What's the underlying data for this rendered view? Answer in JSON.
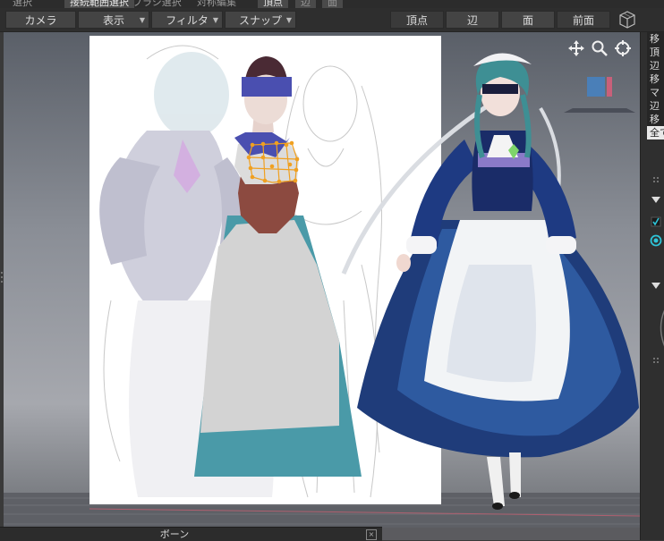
{
  "top_modes": [
    "選択",
    "接続範囲選択",
    "ブラシ選択",
    "対称編集",
    "頂点",
    "辺",
    "面"
  ],
  "toolbar": {
    "camera_label": "カメラ",
    "view_label": "表示",
    "filter_label": "フィルタ",
    "snap_label": "スナップ",
    "vertex_label": "頂点",
    "edge_label": "辺",
    "face_label": "面",
    "front_label": "前面",
    "cube_icon": "cube-view-icon"
  },
  "viewport": {
    "nav_icons": [
      "move-icon",
      "zoom-icon",
      "orbit-icon"
    ]
  },
  "right_panel": {
    "items": [
      "移",
      "頂",
      "辺",
      "移",
      "マ",
      "辺",
      "移",
      "全て"
    ]
  },
  "bottom_panel": {
    "title": "ボーン",
    "close": "×"
  },
  "colors": {
    "accent_cyan": "#2ec4d8",
    "mesh_blue": "#4a4fb0",
    "mesh_brown": "#8c4a40",
    "mesh_gray": "#d3d3d3",
    "mesh_teal": "#4a9aa8",
    "selection_orange": "#f0a020"
  }
}
